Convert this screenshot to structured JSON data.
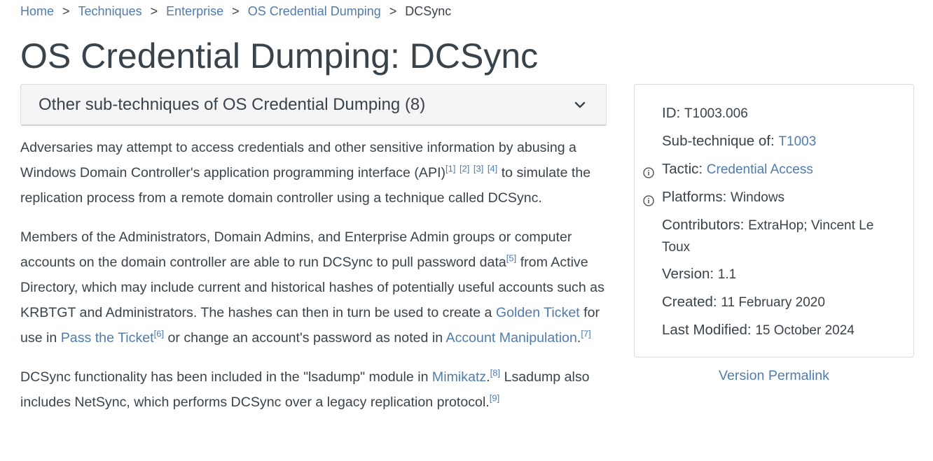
{
  "breadcrumb": {
    "items": [
      "Home",
      "Techniques",
      "Enterprise",
      "OS Credential Dumping"
    ],
    "current": "DCSync",
    "separator": ">"
  },
  "page_title": "OS Credential Dumping: DCSync",
  "subtechniques": {
    "label": "Other sub-techniques of OS Credential Dumping (8)",
    "icon": "chevron-down-icon"
  },
  "description": {
    "p1": {
      "t1": "Adversaries may attempt to access credentials and other sensitive information by abusing a Windows Domain Controller's application programming interface (API)",
      "ref1": "[1]",
      "ref2": "[2]",
      "ref3": "[3]",
      "ref4": "[4]",
      "t2": " to simulate the replication process from a remote domain controller using a technique called DCSync."
    },
    "p2": {
      "t1": "Members of the Administrators, Domain Admins, and Enterprise Admin groups or computer accounts on the domain controller are able to run DCSync to pull password data",
      "ref5": "[5]",
      "t2": " from Active Directory, which may include current and historical hashes of potentially useful accounts such as KRBTGT and Administrators. The hashes can then in turn be used to create a ",
      "link_golden": "Golden Ticket",
      "t3": " for use in ",
      "link_ptt": "Pass the Ticket",
      "ref6": "[6]",
      "t4": " or change an account's password as noted in ",
      "link_acct": "Account Manipulation",
      "t5": ".",
      "ref7": "[7]"
    },
    "p3": {
      "t1": "DCSync functionality has been included in the \"lsadump\" module in ",
      "link_mimikatz": "Mimikatz",
      "t2": ".",
      "ref8": "[8]",
      "t3": " Lsadump also includes NetSync, which performs DCSync over a legacy replication protocol.",
      "ref9": "[9]"
    }
  },
  "card": {
    "id_label": "ID: ",
    "id_value": "T1003.006",
    "sub_label": "Sub-technique of: ",
    "sub_value": "T1003",
    "tactic_label": "Tactic: ",
    "tactic_value": "Credential Access",
    "platforms_label": "Platforms: ",
    "platforms_value": "Windows",
    "contributors_label": "Contributors: ",
    "contributors_value": "ExtraHop; Vincent Le Toux",
    "version_label": "Version: ",
    "version_value": "1.1",
    "created_label": "Created: ",
    "created_value": "11 February 2020",
    "modified_label": "Last Modified: ",
    "modified_value": "15 October 2024"
  },
  "permalink": "Version Permalink",
  "colors": {
    "link": "#4f7cac",
    "text": "#39434c",
    "panel_bg": "#f5f5f5",
    "border": "#dcdcdc"
  }
}
